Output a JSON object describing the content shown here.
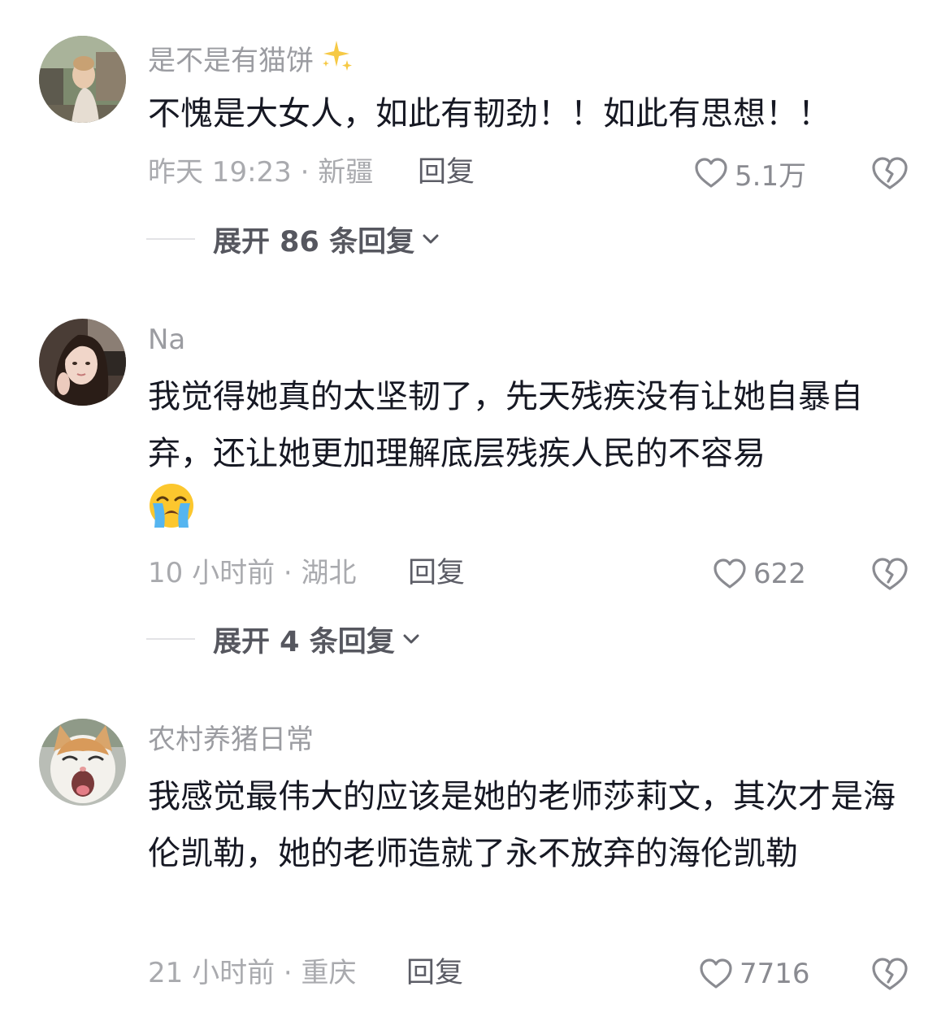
{
  "comments": [
    {
      "username": "是不是有猫饼",
      "username_icon": "sparkles-emoji",
      "text": "不愧是大女人，如此有韧劲！！如此有思想！！",
      "time_location": "昨天 19:23 · 新疆",
      "reply_label": "回复",
      "likes": "5.1万",
      "expand_label": "展开 86 条回复"
    },
    {
      "username": "Na",
      "text": "我觉得她真的太坚韧了，先天残疾没有让她自暴自弃，还让她更加理解底层残疾人民的不容易",
      "text_emoji": "loudly-crying-face-emoji",
      "time_location": "10 小时前 · 湖北",
      "reply_label": "回复",
      "likes": "622",
      "expand_label": "展开 4 条回复"
    },
    {
      "username": "农村养猪日常",
      "text": "我感觉最伟大的应该是她的老师莎莉文，其次才是海伦凯勒，她的老师造就了永不放弃的海伦凯勒",
      "time_location": "21 小时前 · 重庆",
      "reply_label": "回复",
      "likes": "7716"
    }
  ],
  "colors": {
    "username": "#9b9ca1",
    "text": "#161823",
    "meta": "#a9aaae",
    "reply": "#5c5d66",
    "expand": "#56575f",
    "icon": "#8a8b91"
  }
}
